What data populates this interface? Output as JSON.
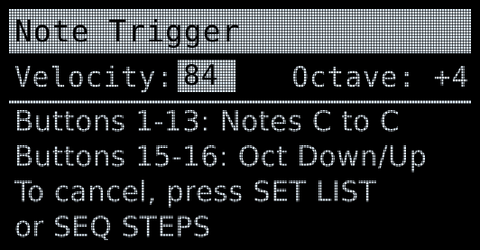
{
  "screen": {
    "title": "Note Trigger",
    "velocity_label": "Velocity:",
    "velocity_value": "84",
    "octave_label": "Octave:",
    "octave_value": "+4",
    "lines": [
      "Buttons 1-13: Notes C to C",
      "Buttons 15-16: Oct Down/Up",
      "To cancel, press SET LIST",
      "or SEQ STEPS"
    ]
  },
  "colors": {
    "background": "#000000",
    "lcd_text": "#dce9f3",
    "inverse_text": "#050505"
  }
}
